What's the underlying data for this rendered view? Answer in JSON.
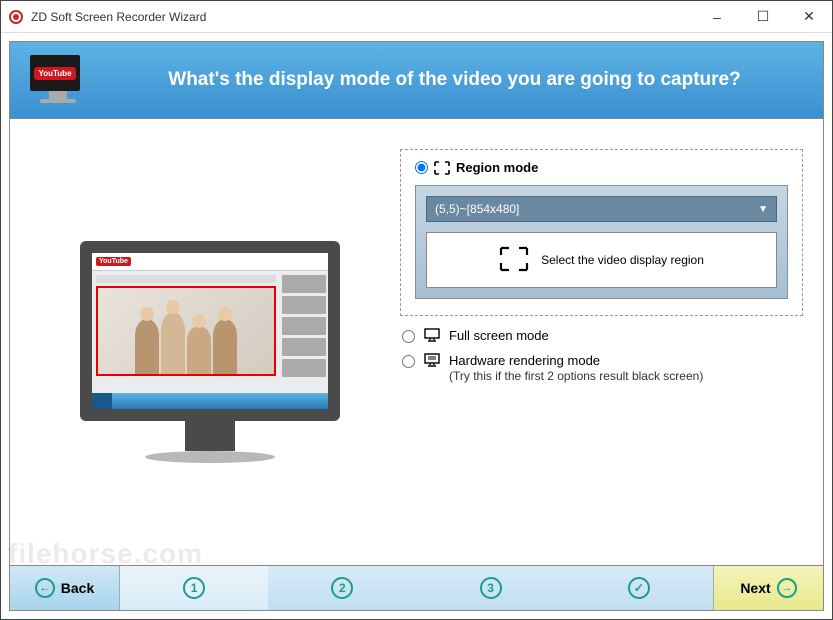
{
  "window": {
    "title": "ZD Soft Screen Recorder Wizard"
  },
  "banner": {
    "icon_badge": "YouTube",
    "heading": "What's the display mode of the video you are going to capture?"
  },
  "options": {
    "region": {
      "label": "Region mode",
      "selected": true,
      "dropdown_value": "(5,5)~[854x480]",
      "button_label": "Select the video display region"
    },
    "fullscreen": {
      "label": "Full screen mode",
      "selected": false
    },
    "hardware": {
      "label": "Hardware rendering mode",
      "sub": "(Try this if the first 2 options result black screen)",
      "selected": false
    }
  },
  "footer": {
    "back": "Back",
    "next": "Next",
    "steps": [
      "1",
      "2",
      "3"
    ],
    "current_step": 1
  },
  "watermark": "filehorse.com"
}
